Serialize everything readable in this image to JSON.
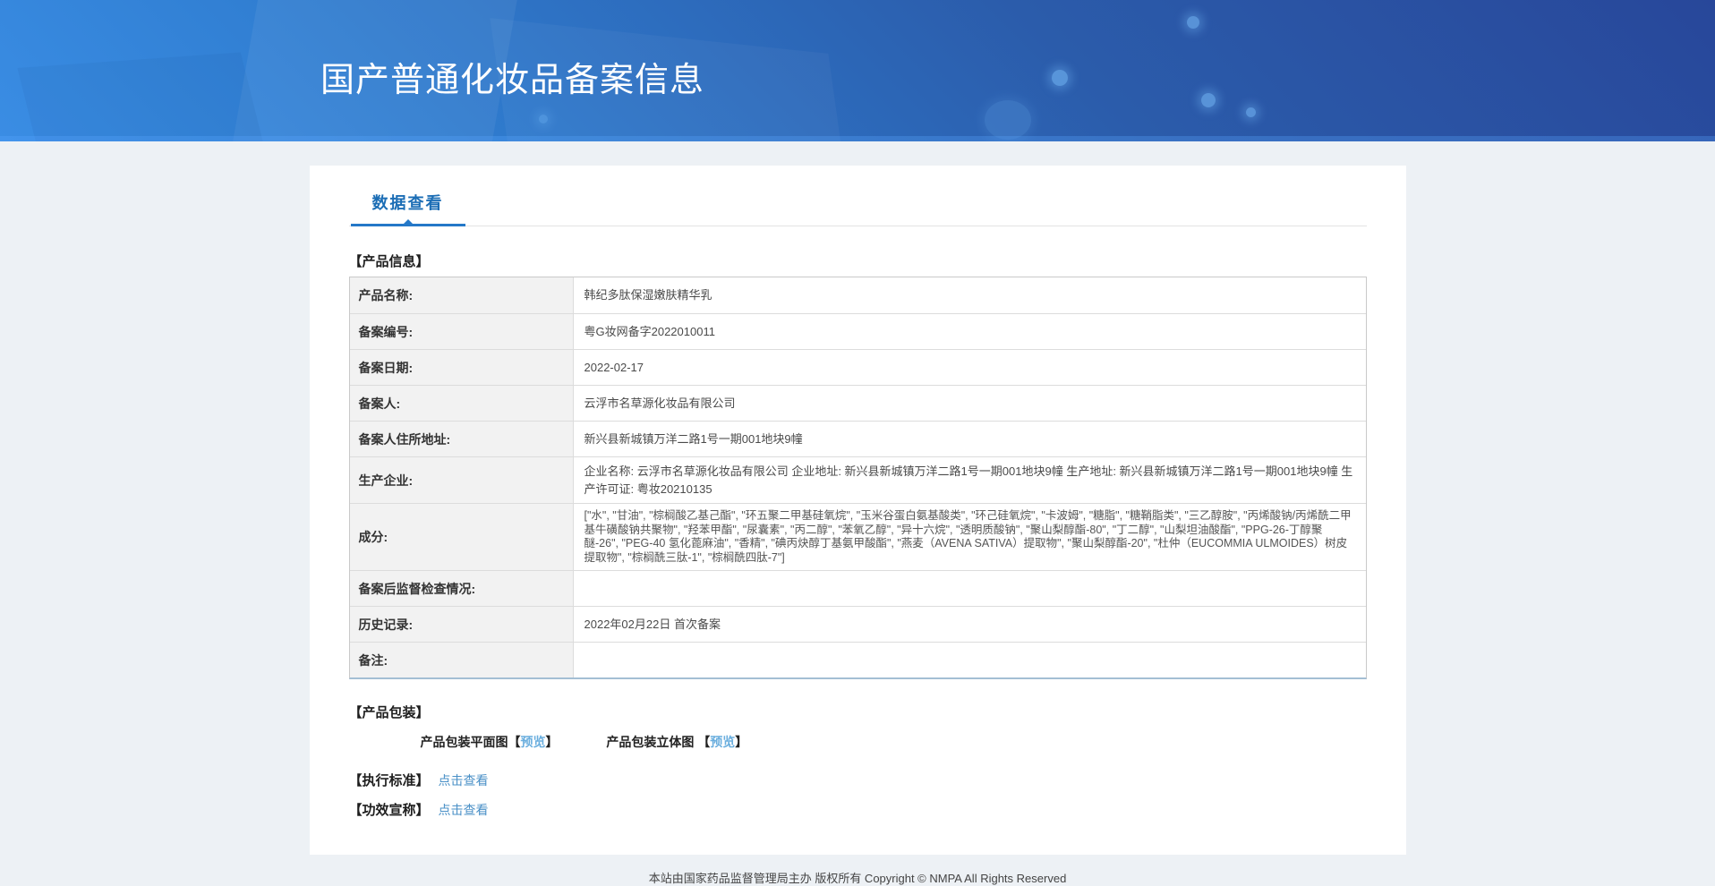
{
  "header": {
    "title": "国产普通化妆品备案信息"
  },
  "tabs": [
    {
      "label": "数据查看"
    }
  ],
  "product_info": {
    "section_title": "【产品信息】",
    "rows": [
      {
        "label": "产品名称:",
        "value": "韩纪多肽保湿嫩肤精华乳"
      },
      {
        "label": "备案编号:",
        "value": "粤G妆网备字2022010011"
      },
      {
        "label": "备案日期:",
        "value": "2022-02-17"
      },
      {
        "label": "备案人:",
        "value": "云浮市名草源化妆品有限公司"
      },
      {
        "label": "备案人住所地址:",
        "value": "新兴县新城镇万洋二路1号一期001地块9幢"
      },
      {
        "label": "生产企业:",
        "value": "企业名称: 云浮市名草源化妆品有限公司 企业地址: 新兴县新城镇万洋二路1号一期001地块9幢 生产地址: 新兴县新城镇万洋二路1号一期001地块9幢 生产许可证: 粤妆20210135"
      },
      {
        "label": "成分:",
        "value": "[\"水\", \"甘油\", \"棕榈酸乙基己酯\", \"环五聚二甲基硅氧烷\", \"玉米谷蛋白氨基酸类\", \"环己硅氧烷\", \"卡波姆\", \"糖脂\", \"糖鞘脂类\", \"三乙醇胺\", \"丙烯酸钠/丙烯酰二甲基牛磺酸钠共聚物\", \"羟苯甲酯\", \"尿囊素\", \"丙二醇\", \"苯氧乙醇\", \"异十六烷\", \"透明质酸钠\", \"聚山梨醇酯-80\", \"丁二醇\", \"山梨坦油酸酯\", \"PPG-26-丁醇聚醚-26\", \"PEG-40 氢化蓖麻油\", \"香精\", \"碘丙炔醇丁基氨甲酸酯\", \"燕麦（AVENA SATIVA）提取物\", \"聚山梨醇酯-20\", \"杜仲（EUCOMMIA ULMOIDES）树皮提取物\", \"棕榈酰三肽-1\", \"棕榈酰四肽-7\"]"
      },
      {
        "label": "备案后监督检查情况:",
        "value": ""
      },
      {
        "label": "历史记录:",
        "value": "2022年02月22日 首次备案"
      },
      {
        "label": "备注:",
        "value": ""
      }
    ]
  },
  "packaging": {
    "section_title": "【产品包装】",
    "items": [
      {
        "prefix": "产品包装平面图【",
        "link": "预览",
        "suffix": "】"
      },
      {
        "prefix": "产品包装立体图 【",
        "link": "预览",
        "suffix": "】"
      }
    ]
  },
  "standards": {
    "title": "【执行标准】",
    "link": "点击查看"
  },
  "efficacy": {
    "title": "【功效宣称】",
    "link": "点击查看"
  },
  "footer": {
    "text": "本站由国家药品监督管理局主办 版权所有 Copyright © NMPA All Rights Reserved"
  },
  "colors": {
    "header_gradient_top": "#28479a",
    "header_gradient_bottom": "#3a8de4",
    "tab_accent": "#2478c8",
    "tab_text": "#1b6db5",
    "view_link_blue": "#4a90c7",
    "preview_link_blue": "#6aaede",
    "table_label_bg": "#f2f2f2",
    "table_bottom_border": "#a4bfd4",
    "page_background": "#edf1f5"
  }
}
